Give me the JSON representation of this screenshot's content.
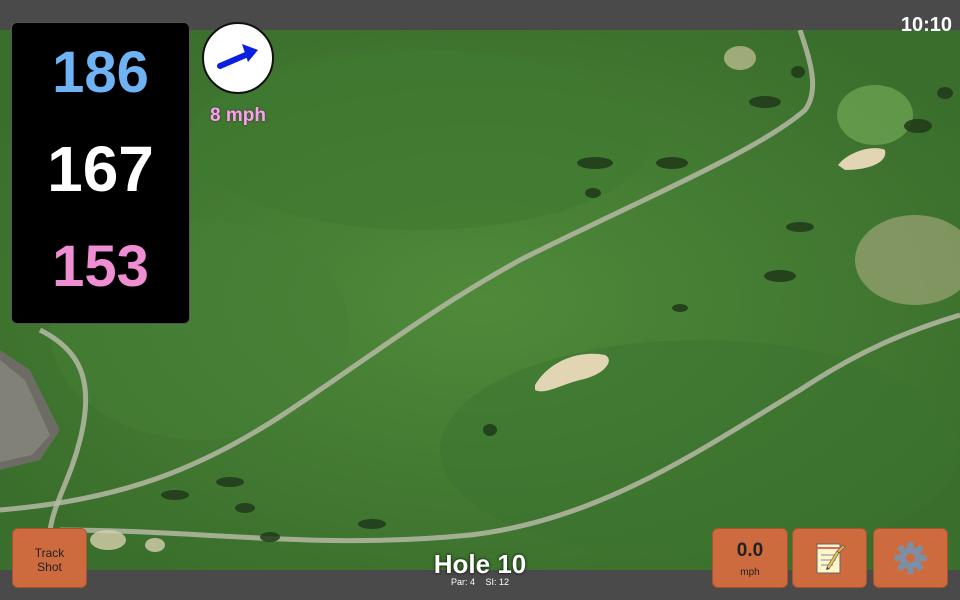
{
  "status_bar": {
    "time": "10:10"
  },
  "distances": {
    "back": "186",
    "center": "167",
    "front": "153"
  },
  "wind": {
    "speed": "8 mph",
    "arrow_color": "#0a1fe0",
    "icon": "wind-arrow-icon"
  },
  "buttons": {
    "track_shot": "Track\nShot",
    "speed_value": "0.0",
    "speed_unit": "mph",
    "notes_icon": "notepad-icon",
    "settings_icon": "gear-icon"
  },
  "hole": {
    "title": "Hole 10",
    "par": "Par: 4",
    "si": "SI: 12"
  },
  "colors": {
    "back_distance": "#6fb3f5",
    "center_distance": "#ffffff",
    "front_distance": "#f08ed4",
    "button": "#cd6b3f",
    "wind_text": "#ff9ff0"
  }
}
